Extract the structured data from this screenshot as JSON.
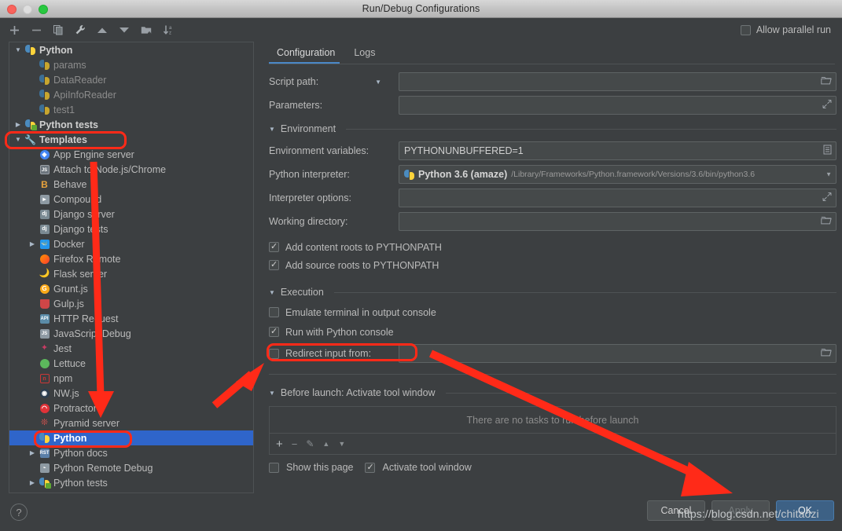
{
  "window": {
    "title": "Run/Debug Configurations",
    "traffic_lights": [
      "close-red",
      "minimize-yellow",
      "zoom-green"
    ]
  },
  "left_toolbar": {
    "buttons": [
      {
        "name": "add",
        "glyph": "+"
      },
      {
        "name": "remove",
        "glyph": "−"
      },
      {
        "name": "copy",
        "glyph": "❐"
      },
      {
        "name": "edit-templates",
        "glyph": "🔧"
      },
      {
        "name": "move-up",
        "glyph": "▲"
      },
      {
        "name": "move-down",
        "glyph": "▼"
      },
      {
        "name": "new-folder",
        "glyph": "🗀"
      },
      {
        "name": "sort-alphabetically",
        "glyph": "↓"
      }
    ]
  },
  "tree": {
    "items": [
      {
        "label": "Python",
        "level": 0,
        "arrow": "down",
        "icon": "python",
        "bold": true,
        "dim": false,
        "selected": false
      },
      {
        "label": "params",
        "level": 1,
        "arrow": "none",
        "icon": "python-dim",
        "bold": false,
        "dim": true,
        "selected": false
      },
      {
        "label": "DataReader",
        "level": 1,
        "arrow": "none",
        "icon": "python-dim",
        "bold": false,
        "dim": true,
        "selected": false
      },
      {
        "label": "ApiInfoReader",
        "level": 1,
        "arrow": "none",
        "icon": "python-dim",
        "bold": false,
        "dim": true,
        "selected": false
      },
      {
        "label": "test1",
        "level": 1,
        "arrow": "none",
        "icon": "python-dim",
        "bold": false,
        "dim": true,
        "selected": false
      },
      {
        "label": "Python tests",
        "level": 0,
        "arrow": "right",
        "icon": "python-tests",
        "bold": true,
        "dim": false,
        "selected": false
      },
      {
        "label": "Templates",
        "level": 0,
        "arrow": "down",
        "icon": "wrench",
        "bold": true,
        "dim": false,
        "selected": false
      },
      {
        "label": "App Engine server",
        "level": 1,
        "arrow": "none",
        "icon": "app-engine",
        "bold": false,
        "dim": false,
        "selected": false
      },
      {
        "label": "Attach to Node.js/Chrome",
        "level": 1,
        "arrow": "none",
        "icon": "nodejs",
        "bold": false,
        "dim": false,
        "selected": false
      },
      {
        "label": "Behave",
        "level": 1,
        "arrow": "none",
        "icon": "behave",
        "bold": false,
        "dim": false,
        "selected": false
      },
      {
        "label": "Compound",
        "level": 1,
        "arrow": "none",
        "icon": "compound",
        "bold": false,
        "dim": false,
        "selected": false
      },
      {
        "label": "Django server",
        "level": 1,
        "arrow": "none",
        "icon": "django",
        "bold": false,
        "dim": false,
        "selected": false
      },
      {
        "label": "Django tests",
        "level": 1,
        "arrow": "none",
        "icon": "django-tests",
        "bold": false,
        "dim": false,
        "selected": false
      },
      {
        "label": "Docker",
        "level": 1,
        "arrow": "right",
        "icon": "docker",
        "bold": false,
        "dim": false,
        "selected": false
      },
      {
        "label": "Firefox Remote",
        "level": 1,
        "arrow": "none",
        "icon": "firefox",
        "bold": false,
        "dim": false,
        "selected": false
      },
      {
        "label": "Flask server",
        "level": 1,
        "arrow": "none",
        "icon": "flask",
        "bold": false,
        "dim": false,
        "selected": false
      },
      {
        "label": "Grunt.js",
        "level": 1,
        "arrow": "none",
        "icon": "grunt",
        "bold": false,
        "dim": false,
        "selected": false
      },
      {
        "label": "Gulp.js",
        "level": 1,
        "arrow": "none",
        "icon": "gulp",
        "bold": false,
        "dim": false,
        "selected": false
      },
      {
        "label": "HTTP Request",
        "level": 1,
        "arrow": "none",
        "icon": "http-request",
        "bold": false,
        "dim": false,
        "selected": false
      },
      {
        "label": "JavaScript Debug",
        "level": 1,
        "arrow": "none",
        "icon": "js-debug",
        "bold": false,
        "dim": false,
        "selected": false
      },
      {
        "label": "Jest",
        "level": 1,
        "arrow": "none",
        "icon": "jest",
        "bold": false,
        "dim": false,
        "selected": false
      },
      {
        "label": "Lettuce",
        "level": 1,
        "arrow": "none",
        "icon": "lettuce",
        "bold": false,
        "dim": false,
        "selected": false
      },
      {
        "label": "npm",
        "level": 1,
        "arrow": "none",
        "icon": "npm",
        "bold": false,
        "dim": false,
        "selected": false
      },
      {
        "label": "NW.js",
        "level": 1,
        "arrow": "none",
        "icon": "nwjs",
        "bold": false,
        "dim": false,
        "selected": false
      },
      {
        "label": "Protractor",
        "level": 1,
        "arrow": "none",
        "icon": "protractor",
        "bold": false,
        "dim": false,
        "selected": false
      },
      {
        "label": "Pyramid server",
        "level": 1,
        "arrow": "none",
        "icon": "pyramid",
        "bold": false,
        "dim": false,
        "selected": false
      },
      {
        "label": "Python",
        "level": 1,
        "arrow": "none",
        "icon": "python",
        "bold": true,
        "dim": false,
        "selected": true
      },
      {
        "label": "Python docs",
        "level": 1,
        "arrow": "right",
        "icon": "python-docs",
        "bold": false,
        "dim": false,
        "selected": false
      },
      {
        "label": "Python Remote Debug",
        "level": 1,
        "arrow": "none",
        "icon": "remote-debug",
        "bold": false,
        "dim": false,
        "selected": false
      },
      {
        "label": "Python tests",
        "level": 1,
        "arrow": "right",
        "icon": "python-tests",
        "bold": false,
        "dim": false,
        "selected": false
      }
    ]
  },
  "help_button": {
    "label": "?"
  },
  "right_panel": {
    "allow_parallel_run": {
      "label": "Allow parallel run",
      "checked": false
    },
    "tabs": [
      {
        "label": "Configuration",
        "active": true
      },
      {
        "label": "Logs",
        "active": false
      }
    ],
    "fields": {
      "script_path": {
        "label": "Script path:",
        "value": "",
        "has_dropdown": true,
        "end_icon": "folder-icon"
      },
      "parameters": {
        "label": "Parameters:",
        "value": "",
        "end_icon": "expand-icon"
      }
    },
    "environment_section": {
      "title": "Environment",
      "expanded": true,
      "environment_variables": {
        "label": "Environment variables:",
        "value": "PYTHONUNBUFFERED=1",
        "end_icon": "list-icon"
      },
      "python_interpreter": {
        "label": "Python interpreter:",
        "value_name": "Python 3.6 (amaze)",
        "value_path": "/Library/Frameworks/Python.framework/Versions/3.6/bin/python3.6",
        "end_icon": "chevron-down-icon"
      },
      "interpreter_options": {
        "label": "Interpreter options:",
        "value": "",
        "end_icon": "expand-icon"
      },
      "working_directory": {
        "label": "Working directory:",
        "value": "",
        "end_icon": "folder-icon"
      },
      "checkboxes": [
        {
          "label": "Add content roots to PYTHONPATH",
          "checked": true
        },
        {
          "label": "Add source roots to PYTHONPATH",
          "checked": true
        }
      ]
    },
    "execution_section": {
      "title": "Execution",
      "expanded": true,
      "checkboxes": [
        {
          "label": "Emulate terminal in output console",
          "checked": false
        },
        {
          "label": "Run with Python console",
          "checked": true
        }
      ],
      "redirect_input": {
        "label": "Redirect input from:",
        "checked": false,
        "value": "",
        "end_icon": "folder-icon"
      }
    },
    "before_launch_section": {
      "title": "Before launch: Activate tool window",
      "expanded": true,
      "empty_text": "There are no tasks to run before launch",
      "tools": [
        {
          "name": "add",
          "glyph": "+"
        },
        {
          "name": "remove",
          "glyph": "−"
        },
        {
          "name": "edit",
          "glyph": "✎"
        },
        {
          "name": "move-up",
          "glyph": "▲"
        },
        {
          "name": "move-down",
          "glyph": "▼"
        }
      ],
      "checkboxes": [
        {
          "label": "Show this page",
          "checked": false
        },
        {
          "label": "Activate tool window",
          "checked": true
        }
      ]
    },
    "buttons": [
      {
        "label": "Cancel",
        "style": "normal"
      },
      {
        "label": "Apply",
        "style": "disabled"
      },
      {
        "label": "OK",
        "style": "primary"
      }
    ]
  },
  "annotations": {
    "highlight_boxes": [
      {
        "name": "templates-highlight",
        "target": "Templates"
      },
      {
        "name": "python-template-highlight",
        "target": "Python"
      },
      {
        "name": "run-with-python-console-highlight",
        "target": "Run with Python console"
      }
    ],
    "arrows": [
      {
        "name": "templates-to-python-arrow"
      },
      {
        "name": "python-to-run-console-arrow"
      },
      {
        "name": "run-console-to-ok-arrow"
      }
    ],
    "color": "#ff2a18"
  },
  "watermark": {
    "text": "https://blog.csdn.net/chitaozi"
  }
}
